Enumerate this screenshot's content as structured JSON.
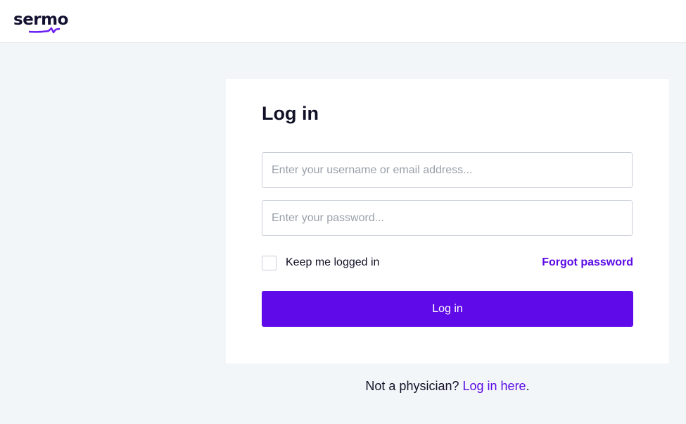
{
  "header": {
    "logo_text": "sermo",
    "brand_color": "#5f0ae8"
  },
  "login": {
    "title": "Log in",
    "username_placeholder": "Enter your username or email address...",
    "password_placeholder": "Enter your password...",
    "keep_logged_in_label": "Keep me logged in",
    "keep_logged_in_checked": false,
    "forgot_password_label": "Forgot password",
    "submit_label": "Log in"
  },
  "footer": {
    "prompt": "Not a physician?",
    "link_label": "Log in here",
    "suffix": "."
  }
}
